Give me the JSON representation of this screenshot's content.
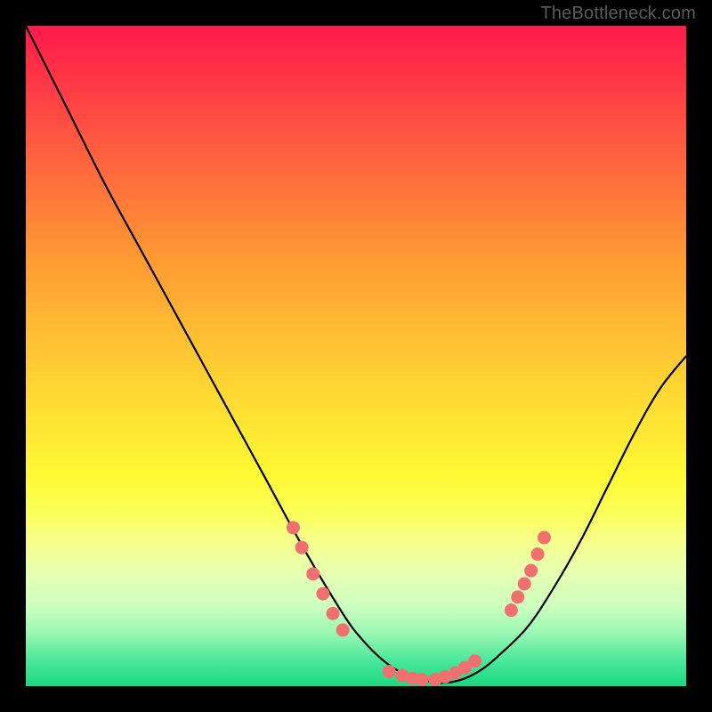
{
  "watermark": "TheBottleneck.com",
  "chart_data": {
    "type": "line",
    "title": "",
    "xlabel": "",
    "ylabel": "",
    "xlim": [
      0,
      100
    ],
    "ylim": [
      0,
      100
    ],
    "series": [
      {
        "name": "curve",
        "x": [
          0,
          6,
          12,
          18,
          24,
          30,
          36,
          42,
          48,
          51,
          54,
          57,
          60,
          63,
          66,
          69,
          72,
          76,
          80,
          84,
          88,
          92,
          96,
          100
        ],
        "y": [
          100,
          88,
          76,
          65,
          54,
          43,
          32,
          21,
          11,
          7,
          4,
          2,
          1,
          0.5,
          1,
          2.5,
          5,
          9,
          15,
          22,
          30,
          38,
          45,
          50
        ]
      }
    ],
    "markers": [
      {
        "x": 40.5,
        "y": 24
      },
      {
        "x": 41.8,
        "y": 21
      },
      {
        "x": 43.5,
        "y": 17
      },
      {
        "x": 45.0,
        "y": 14
      },
      {
        "x": 46.5,
        "y": 11
      },
      {
        "x": 48.0,
        "y": 8.5
      },
      {
        "x": 55.0,
        "y": 2.2
      },
      {
        "x": 57.0,
        "y": 1.6
      },
      {
        "x": 58.5,
        "y": 1.2
      },
      {
        "x": 60.0,
        "y": 1.0
      },
      {
        "x": 62.0,
        "y": 1.0
      },
      {
        "x": 63.5,
        "y": 1.4
      },
      {
        "x": 65.0,
        "y": 2.0
      },
      {
        "x": 66.5,
        "y": 2.8
      },
      {
        "x": 68.0,
        "y": 3.8
      },
      {
        "x": 73.5,
        "y": 11.5
      },
      {
        "x": 74.5,
        "y": 13.5
      },
      {
        "x": 75.5,
        "y": 15.5
      },
      {
        "x": 76.5,
        "y": 17.5
      },
      {
        "x": 77.5,
        "y": 20.0
      },
      {
        "x": 78.5,
        "y": 22.5
      }
    ],
    "marker_color": "#f07070",
    "curve_color": "#000000"
  }
}
